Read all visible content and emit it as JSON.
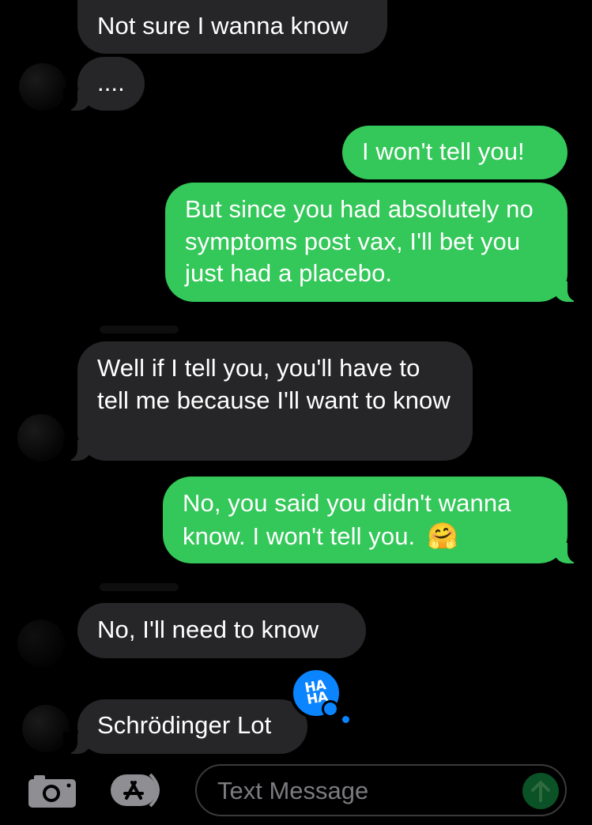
{
  "messages": [
    {
      "direction": "incoming",
      "text": "Not sure I wanna know"
    },
    {
      "direction": "incoming",
      "text": "...."
    },
    {
      "direction": "outgoing",
      "text": "I won't tell you!"
    },
    {
      "direction": "outgoing",
      "text": "But since you had absolutely no symptoms post vax, I'll bet you just had a placebo."
    },
    {
      "direction": "incoming",
      "text": "Well if I tell you, you'll have to tell me because I'll want to know"
    },
    {
      "direction": "outgoing",
      "text": "No, you said you didn't wanna know. I won't tell you.",
      "emoji": "🤗"
    },
    {
      "direction": "incoming",
      "text": "No, I'll need to know"
    },
    {
      "direction": "incoming",
      "text": "Schrödinger Lot",
      "tapback": "HA HA"
    }
  ],
  "tapback": {
    "line1": "HA",
    "line2": "HA",
    "color": "#0a84ff"
  },
  "composer": {
    "placeholder": "Text Message",
    "camera_icon": "camera-icon",
    "apps_icon": "app-store-icon",
    "send_icon": "arrow-up-icon"
  },
  "colors": {
    "background": "#000000",
    "incoming_bubble": "#262628",
    "outgoing_bubble": "#34c759",
    "tapback": "#0a84ff"
  }
}
